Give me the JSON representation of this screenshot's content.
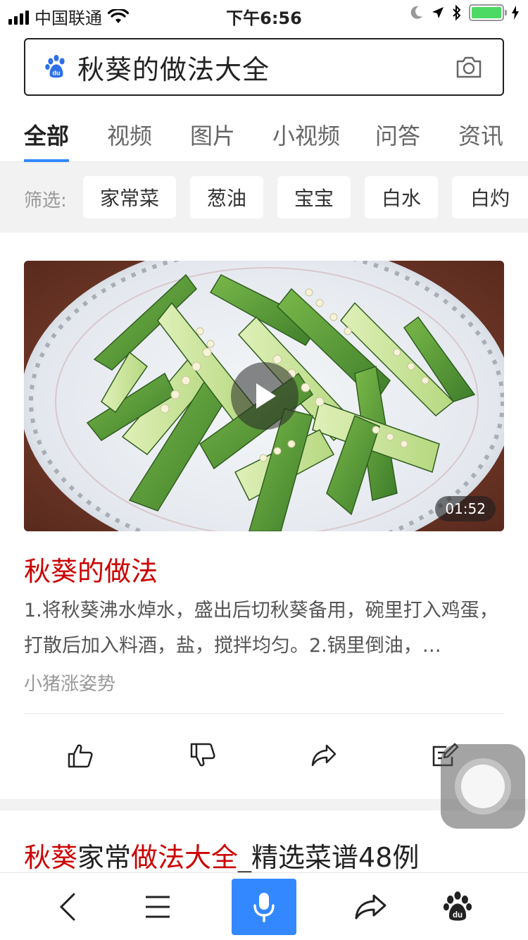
{
  "status_bar": {
    "carrier": "中国联通",
    "time": "下午6:56"
  },
  "search": {
    "query": "秋葵的做法大全",
    "logo_icon": "baidu-paw-icon",
    "camera_icon": "camera-icon"
  },
  "tabs": [
    {
      "label": "全部",
      "active": true
    },
    {
      "label": "视频",
      "active": false
    },
    {
      "label": "图片",
      "active": false
    },
    {
      "label": "小视频",
      "active": false
    },
    {
      "label": "问答",
      "active": false
    },
    {
      "label": "资讯",
      "active": false
    }
  ],
  "filter": {
    "label": "筛选:",
    "chips": [
      "家常菜",
      "葱油",
      "宝宝",
      "白水",
      "白灼"
    ]
  },
  "card": {
    "duration": "01:52",
    "title": "秋葵的做法",
    "description": "1.将秋葵沸水焯水，盛出后切秋葵备用，碗里打入鸡蛋，打散后加入料酒，盐，搅拌均匀。2.锅里倒油，…",
    "source": "小猪涨姿势"
  },
  "actions": [
    "thumbs-up-icon",
    "thumbs-down-icon",
    "share-icon",
    "edit-note-icon"
  ],
  "result2": {
    "title_parts": [
      "秋葵",
      "家常",
      "做法大全",
      "_精选菜谱48例"
    ]
  },
  "colors": {
    "accent": "#3388ff",
    "highlight_red": "#cc0000",
    "battery_green": "#4cd964"
  }
}
